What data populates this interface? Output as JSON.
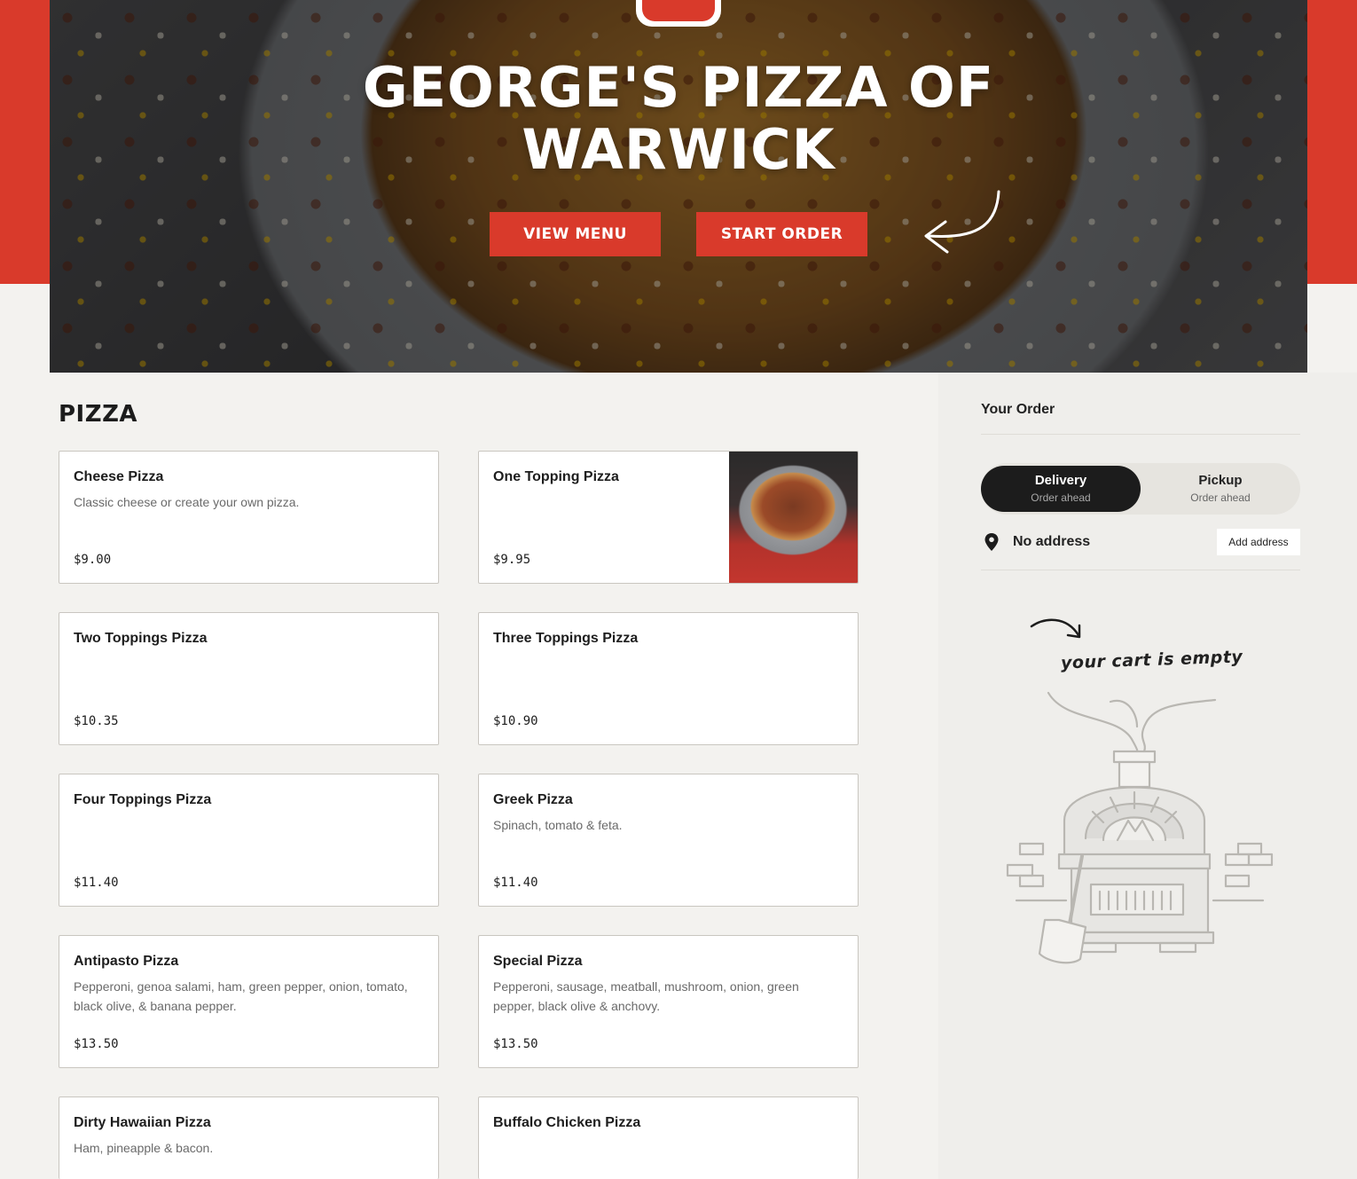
{
  "hero": {
    "title_line1": "GEORGE'S PIZZA OF",
    "title_line2": "WARWICK",
    "view_menu_label": "VIEW MENU",
    "start_order_label": "START ORDER"
  },
  "menu": {
    "section_title": "PIZZA",
    "items": [
      {
        "name": "Cheese Pizza",
        "desc": "Classic cheese or create your own pizza.",
        "price": "$9.00"
      },
      {
        "name": "One Topping Pizza",
        "desc": "",
        "price": "$9.95"
      },
      {
        "name": "Two Toppings Pizza",
        "desc": "",
        "price": "$10.35"
      },
      {
        "name": "Three Toppings Pizza",
        "desc": "",
        "price": "$10.90"
      },
      {
        "name": "Four Toppings Pizza",
        "desc": "",
        "price": "$11.40"
      },
      {
        "name": "Greek Pizza",
        "desc": "Spinach, tomato & feta.",
        "price": "$11.40"
      },
      {
        "name": "Antipasto Pizza",
        "desc": "Pepperoni, genoa salami, ham, green pepper, onion, tomato, black olive, & banana pepper.",
        "price": "$13.50"
      },
      {
        "name": "Special Pizza",
        "desc": "Pepperoni, sausage, meatball, mushroom, onion, green pepper, black olive & anchovy.",
        "price": "$13.50"
      },
      {
        "name": "Dirty Hawaiian Pizza",
        "desc": "Ham, pineapple & bacon.",
        "price": ""
      },
      {
        "name": "Buffalo Chicken Pizza",
        "desc": "",
        "price": ""
      }
    ]
  },
  "order": {
    "title": "Your Order",
    "delivery_label": "Delivery",
    "delivery_sub": "Order ahead",
    "pickup_label": "Pickup",
    "pickup_sub": "Order ahead",
    "address_text": "No address",
    "add_address_label": "Add address",
    "empty_cart_text": "your cart is empty"
  },
  "colors": {
    "brand_red": "#d93a2b",
    "toggle_active": "#1c1c1c",
    "panel_bg": "#efeeeb"
  },
  "icons": {
    "pin": "location-pin-icon",
    "hero_arrow": "curved-arrow-icon",
    "cart_arrow": "squiggle-arrow-icon",
    "oven": "pizza-oven-illustration"
  }
}
